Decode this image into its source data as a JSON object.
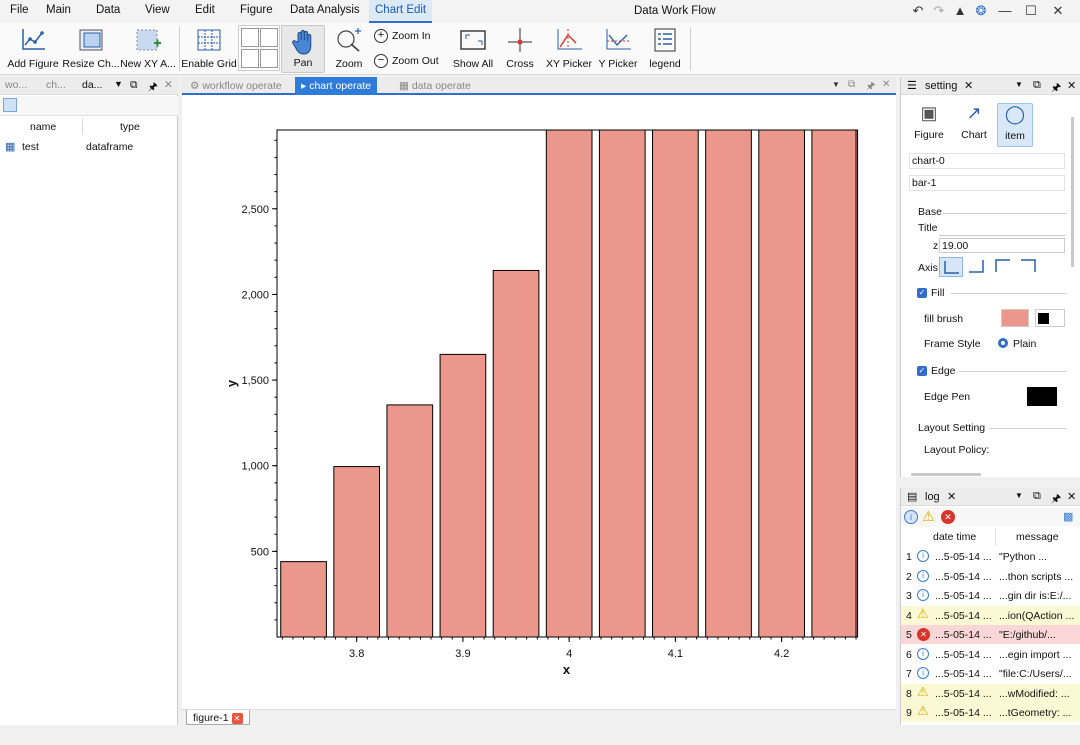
{
  "menubar": {
    "items": [
      "File",
      "Main",
      "Data",
      "View",
      "Edit",
      "Figure",
      "Data Analysis",
      "Chart Edit"
    ],
    "title": "Data Work Flow"
  },
  "ribbon": {
    "add_figure": "Add Figure",
    "resize_chart": "Resize Ch...",
    "new_xy_axis": "New XY A...",
    "enable_grid": "Enable Grid",
    "pan": "Pan",
    "zoom": "Zoom",
    "zoom_in": "Zoom In",
    "zoom_out": "Zoom Out",
    "show_all": "Show All",
    "cross": "Cross",
    "xy_picker": "XY Picker",
    "y_picker": "Y Picker",
    "legend": "legend"
  },
  "left_dock": {
    "tabs": [
      "wo...",
      "ch...",
      "da..."
    ],
    "columns": {
      "name": "name",
      "type": "type"
    },
    "rows": [
      {
        "name": "test",
        "type": "dataframe"
      }
    ]
  },
  "center": {
    "tabs": [
      "workflow operate",
      "chart operate",
      "data operate"
    ],
    "sheet_tab": "figure-1"
  },
  "chart_data": {
    "type": "bar",
    "xlabel": "x",
    "ylabel": "y",
    "x": [
      3.75,
      3.8,
      3.85,
      3.9,
      3.95,
      4.0,
      4.05,
      4.1,
      4.15,
      4.2,
      4.25
    ],
    "values": [
      440,
      995,
      1355,
      1650,
      2140,
      2960,
      2960,
      2960,
      2960,
      2960,
      2960
    ],
    "xlim": [
      3.725,
      4.27
    ],
    "ylim": [
      0,
      2960
    ],
    "xticks": [
      "3.8",
      "3.9",
      "4",
      "4.1",
      "4.2"
    ],
    "yticks": [
      "500",
      "1,000",
      "1,500",
      "2,000",
      "2,500"
    ],
    "bar_color": "#ec978b",
    "edge_color": "#000000"
  },
  "setting": {
    "title": "setting",
    "tabs": [
      "Figure",
      "Chart",
      "item"
    ],
    "chart_field": "chart-0",
    "item_field": "bar-1",
    "base_label": "Base",
    "title_label": "Title",
    "z_label": "z",
    "z_value": "19.00",
    "axis_label": "Axis",
    "fill_label": "Fill",
    "fill_brush_label": "fill brush",
    "fill_color": "#ec978b",
    "frame_style_label": "Frame Style",
    "frame_style_value": "Plain",
    "edge_label": "Edge",
    "edge_pen_label": "Edge Pen",
    "edge_color": "#000000",
    "layout_setting_label": "Layout Setting",
    "layout_policy_label": "Layout Policy:"
  },
  "log": {
    "title": "log",
    "columns": {
      "date": "date time",
      "message": "message"
    },
    "rows": [
      {
        "idx": "1",
        "level": "info",
        "date": "...5-05-14 ...",
        "msg": "\"Python ..."
      },
      {
        "idx": "2",
        "level": "info",
        "date": "...5-05-14 ...",
        "msg": "...thon scripts ..."
      },
      {
        "idx": "3",
        "level": "info",
        "date": "...5-05-14 ...",
        "msg": "...gin dir is:E:/..."
      },
      {
        "idx": "4",
        "level": "warn",
        "date": "...5-05-14 ...",
        "msg": "...ion(QAction ..."
      },
      {
        "idx": "5",
        "level": "err",
        "date": "...5-05-14 ...",
        "msg": "\"E:/github/..."
      },
      {
        "idx": "6",
        "level": "info",
        "date": "...5-05-14 ...",
        "msg": "...egin import ..."
      },
      {
        "idx": "7",
        "level": "info",
        "date": "...5-05-14 ...",
        "msg": "\"file:C:/Users/..."
      },
      {
        "idx": "8",
        "level": "warn",
        "date": "...5-05-14 ...",
        "msg": "...wModified: ..."
      },
      {
        "idx": "9",
        "level": "warn",
        "date": "...5-05-14 ...",
        "msg": "...tGeometry: ..."
      }
    ]
  },
  "colors": {
    "accent": "#2f7bd9",
    "info": "#3a7bd5",
    "warn": "#e0a800",
    "err": "#d9342b"
  }
}
